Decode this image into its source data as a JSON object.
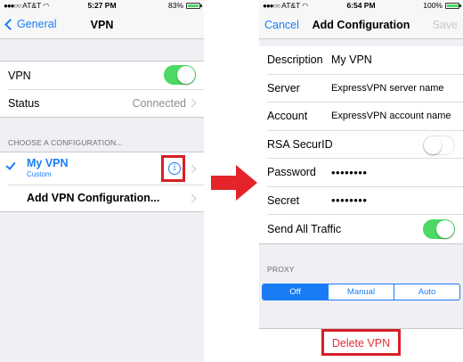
{
  "left_screen": {
    "status_bar": {
      "carrier": "AT&T",
      "time": "5:27 PM",
      "battery": "83%",
      "battery_level": 0.83
    },
    "nav": {
      "back_label": "General",
      "title": "VPN"
    },
    "vpn_row": {
      "label": "VPN",
      "toggle_on": true
    },
    "status_row": {
      "label": "Status",
      "value": "Connected"
    },
    "section_header": "CHOOSE A CONFIGURATION...",
    "configuration": {
      "name": "My VPN",
      "type": "Custom",
      "selected": true
    },
    "add_row": {
      "label": "Add VPN Configuration..."
    }
  },
  "right_screen": {
    "status_bar": {
      "carrier": "AT&T",
      "time": "6:54 PM",
      "battery": "100%",
      "battery_level": 1.0
    },
    "nav": {
      "cancel_label": "Cancel",
      "title": "Add Configuration",
      "save_label": "Save"
    },
    "fields": {
      "description": {
        "label": "Description",
        "value": "My VPN"
      },
      "server": {
        "label": "Server",
        "value": "ExpressVPN server name"
      },
      "account": {
        "label": "Account",
        "value": "ExpressVPN account name"
      },
      "rsa": {
        "label": "RSA SecurID",
        "toggle_on": false
      },
      "password": {
        "label": "Password",
        "value": "••••••••"
      },
      "secret": {
        "label": "Secret",
        "value": "••••••••"
      },
      "send_all": {
        "label": "Send All Traffic",
        "toggle_on": true
      }
    },
    "proxy": {
      "header": "PROXY",
      "options": [
        "Off",
        "Manual",
        "Auto"
      ],
      "selected": "Off"
    },
    "delete_label": "Delete VPN"
  },
  "colors": {
    "accent": "#1a7cf5",
    "toggle_on": "#4cd964",
    "highlight": "#d61f26",
    "delete": "#e0303a"
  },
  "icons": {
    "info": "info-circle-icon",
    "arrow": "right-arrow-icon",
    "check": "checkmark-icon"
  }
}
